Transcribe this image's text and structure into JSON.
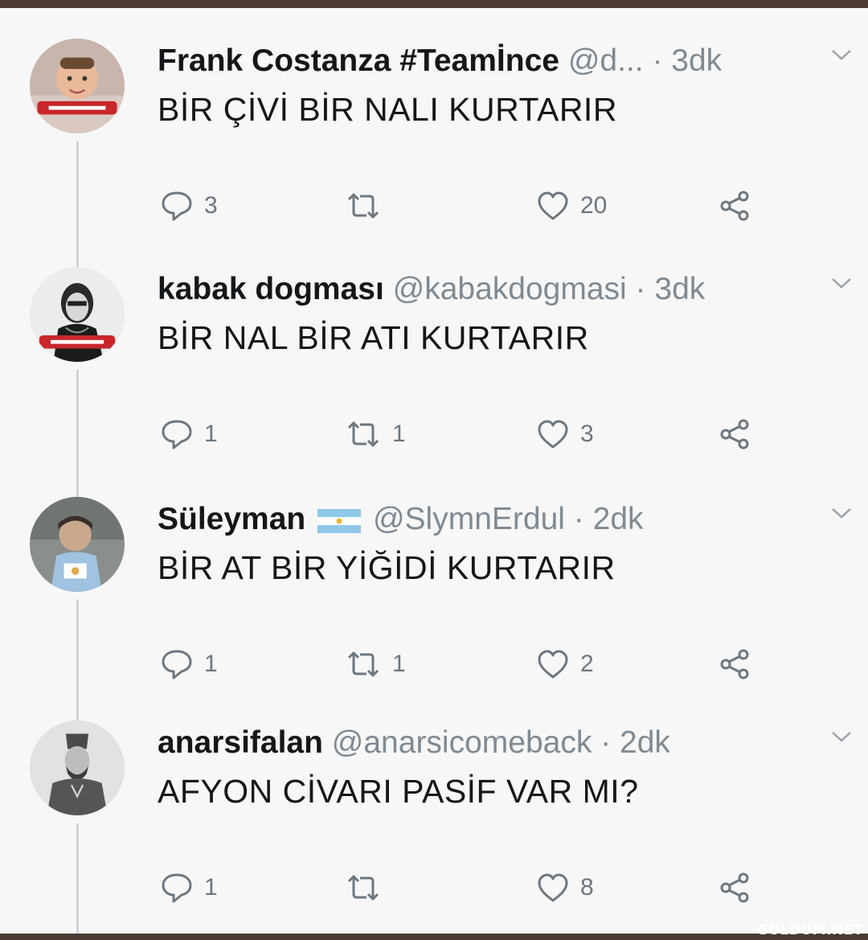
{
  "tweets": [
    {
      "name": "Frank Costanza #Teamİnce",
      "handle": "@d...",
      "time": "3dk",
      "text": "BİR ÇİVİ BİR NALI KURTARIR",
      "replies": "3",
      "retweets": "",
      "likes": "20"
    },
    {
      "name": "kabak dogması",
      "handle": "@kabakdogmasi",
      "time": "3dk",
      "text": "BİR NAL BİR ATI KURTARIR",
      "replies": "1",
      "retweets": "1",
      "likes": "3"
    },
    {
      "name": "Süleyman",
      "handle": "@SlymnErdul",
      "time": "2dk",
      "text": "BİR AT BİR YİĞİDİ KURTARIR",
      "replies": "1",
      "retweets": "1",
      "likes": "2"
    },
    {
      "name": "anarsifalan",
      "handle": "@anarsicomeback",
      "time": "2dk",
      "text": "AFYON CİVARI PASİF VAR MI?",
      "replies": "1",
      "retweets": "",
      "likes": "8"
    }
  ],
  "separator": "·",
  "watermark": "GULDUM.NET",
  "icons": {
    "reply": "speech-bubble-icon",
    "retweet": "retweet-arrows-icon",
    "like": "heart-icon",
    "share": "share-icon",
    "menu": "chevron-down-icon"
  },
  "colors": {
    "background": "#f7f7f7",
    "name": "#14171a",
    "muted": "#7f8a93",
    "frame": "#4a3a33"
  }
}
